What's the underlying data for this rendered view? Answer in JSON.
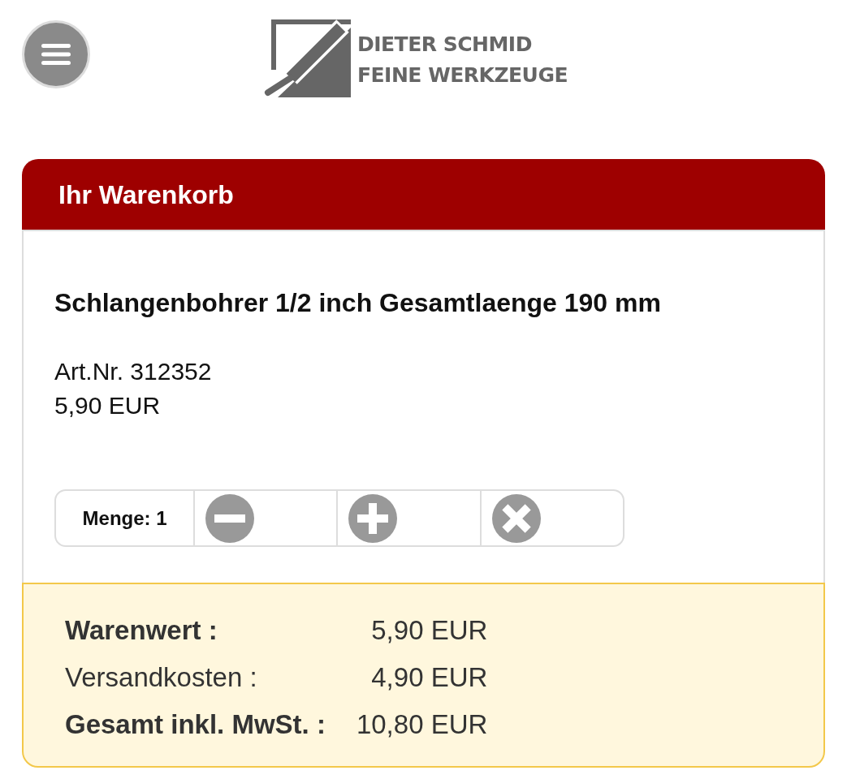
{
  "logo": {
    "line_1": "DIETER SCHMID",
    "line_2": "FEINE WERKZEUGE"
  },
  "cart": {
    "title": "Ihr Warenkorb",
    "items": [
      {
        "name": "Schlangenbohrer 1/2 inch Gesamtlaenge 190 mm",
        "article_number": "Art.Nr. 312352",
        "price": "5,90 EUR",
        "quantity_label": "Menge: 1"
      }
    ]
  },
  "summary": {
    "rows": [
      {
        "label": "Warenwert :",
        "value": "5,90 EUR",
        "bold": true
      },
      {
        "label": "Versandkosten :",
        "value": "4,90 EUR",
        "bold": false
      },
      {
        "label": "Gesamt inkl. MwSt. :",
        "value": "10,80 EUR",
        "bold": true
      }
    ]
  }
}
